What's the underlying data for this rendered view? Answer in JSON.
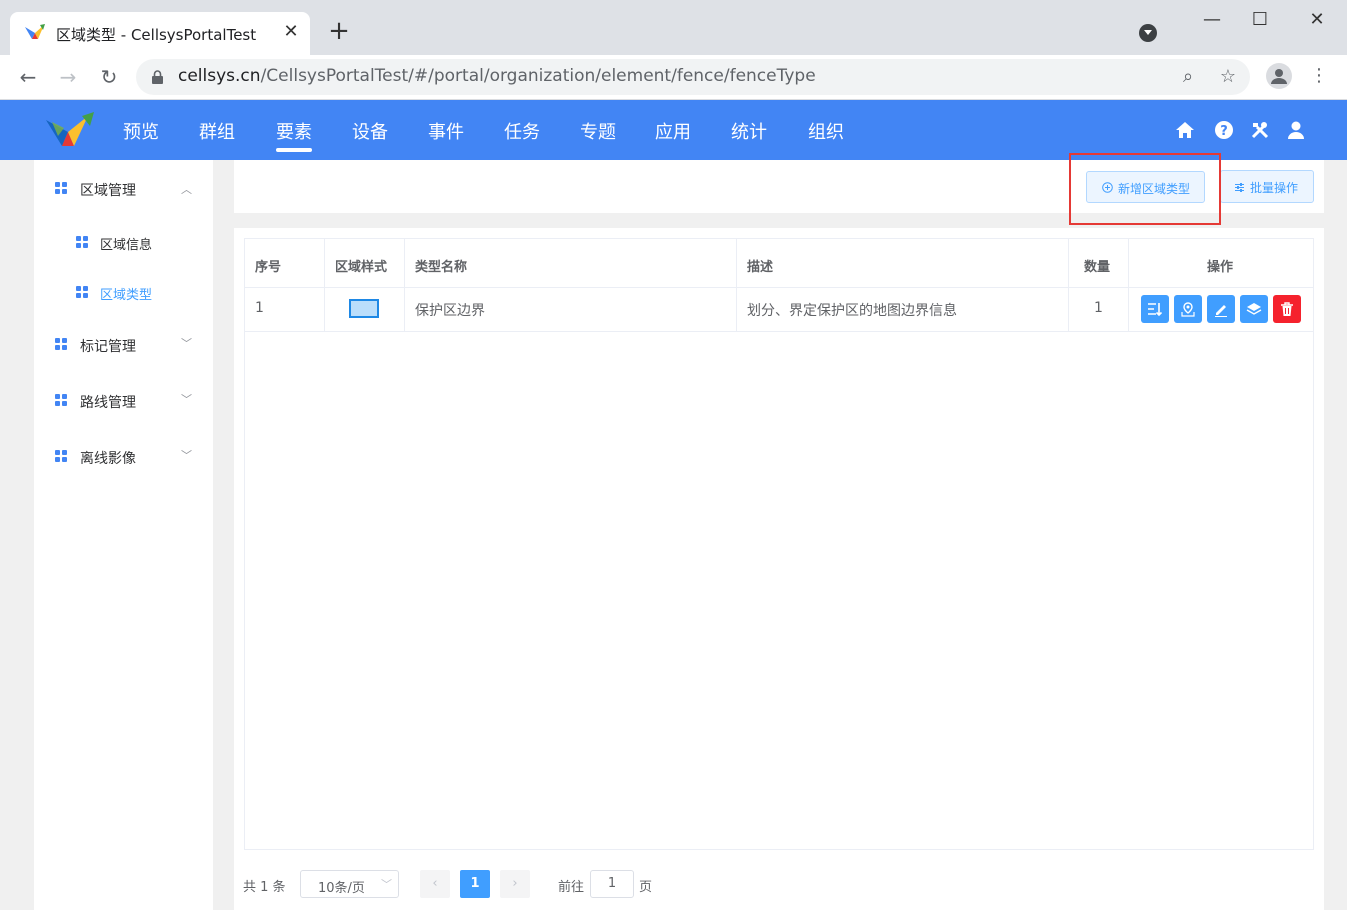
{
  "browser": {
    "tab_title": "区域类型 - CellsysPortalTest",
    "tab_close": "✕",
    "new_tab": "+",
    "url_host": "cellsys.cn",
    "url_path": "/CellsysPortalTest/#/portal/organization/element/fence/fenceType",
    "window_buttons": [
      "—",
      "☐",
      "✕"
    ]
  },
  "header": {
    "nav": [
      {
        "label": "预览"
      },
      {
        "label": "群组"
      },
      {
        "label": "要素",
        "active": true
      },
      {
        "label": "设备"
      },
      {
        "label": "事件"
      },
      {
        "label": "任务"
      },
      {
        "label": "专题"
      },
      {
        "label": "应用"
      },
      {
        "label": "统计"
      },
      {
        "label": "组织"
      }
    ],
    "icons": [
      "home-icon",
      "help-icon",
      "tools-icon",
      "user-icon"
    ]
  },
  "sidebar": {
    "groups": [
      {
        "label": "区域管理",
        "expanded": true,
        "children": [
          {
            "label": "区域信息",
            "active": false
          },
          {
            "label": "区域类型",
            "active": true
          }
        ]
      },
      {
        "label": "标记管理",
        "expanded": false
      },
      {
        "label": "路线管理",
        "expanded": false
      },
      {
        "label": "离线影像",
        "expanded": false
      }
    ]
  },
  "toolbar": {
    "add_label": "新增区域类型",
    "batch_label": "批量操作"
  },
  "table": {
    "columns": [
      "序号",
      "区域样式",
      "类型名称",
      "描述",
      "数量",
      "操作"
    ],
    "rows": [
      {
        "index": "1",
        "name": "保护区边界",
        "description": "划分、界定保护区的地图边界信息",
        "count": "1",
        "actions": [
          "sort-icon",
          "map-marker-icon",
          "edit-icon",
          "layers-icon",
          "delete-icon"
        ]
      }
    ]
  },
  "pagination": {
    "total": "共 1 条",
    "page_size": "10条/页",
    "current_page": "1",
    "goto_prefix": "前往",
    "goto_value": "1",
    "goto_suffix": "页"
  },
  "colors": {
    "header_blue": "#4285f4",
    "primary": "#409eff",
    "danger": "#f5222d",
    "highlight": "#e53935"
  }
}
